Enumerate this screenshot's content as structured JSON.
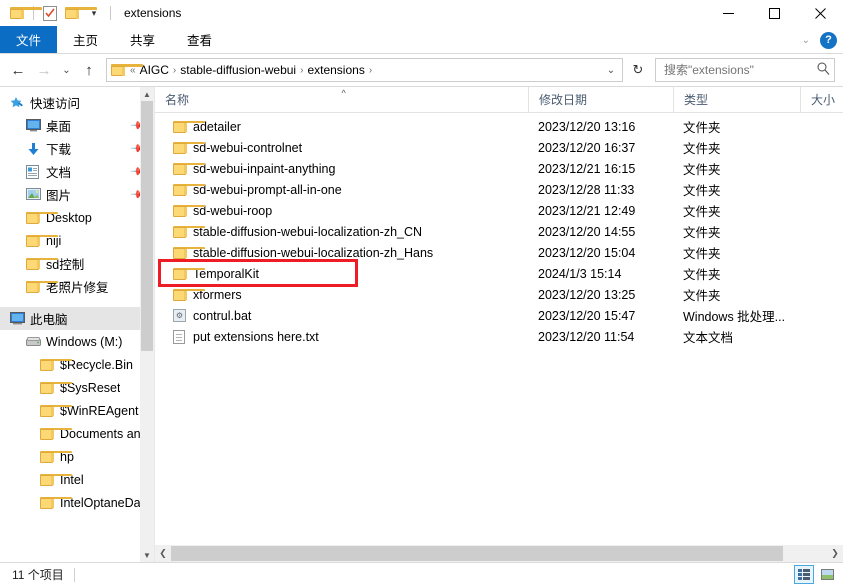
{
  "window": {
    "title": "extensions",
    "controls": {
      "minimize": "—",
      "maximize": "☐",
      "close": "✕"
    },
    "quick_access_toolbar": [
      {
        "name": "folder-icon",
        "label": ""
      },
      {
        "name": "properties-icon",
        "label": ""
      },
      {
        "name": "new-folder-icon",
        "label": ""
      },
      {
        "name": "customize-chevron-icon",
        "label": "▾"
      }
    ]
  },
  "ribbon": {
    "tabs": [
      {
        "label": "文件",
        "active": true
      },
      {
        "label": "主页",
        "active": false
      },
      {
        "label": "共享",
        "active": false
      },
      {
        "label": "查看",
        "active": false
      }
    ],
    "collapse_icon": "⌄",
    "help_icon": "?"
  },
  "navigation": {
    "back": "←",
    "forward": "→",
    "recent": "⌄",
    "up": "↑",
    "refresh": "↻",
    "breadcrumb": {
      "overflow": "«",
      "parts": [
        "AIGC",
        "stable-diffusion-webui",
        "extensions"
      ],
      "separator": "›",
      "dropdown": "⌄"
    },
    "search": {
      "placeholder": "搜索\"extensions\"",
      "value": "",
      "icon": "search-icon"
    }
  },
  "sidebar": {
    "groups": [
      {
        "header": {
          "label": "快速访问",
          "icon": "star-pin-icon"
        },
        "items": [
          {
            "label": "桌面",
            "icon": "desktop-icon",
            "pinned": true
          },
          {
            "label": "下载",
            "icon": "download-icon",
            "pinned": true
          },
          {
            "label": "文档",
            "icon": "documents-icon",
            "pinned": true
          },
          {
            "label": "图片",
            "icon": "pictures-icon",
            "pinned": true
          },
          {
            "label": "Desktop",
            "icon": "folder-icon",
            "pinned": false
          },
          {
            "label": "niji",
            "icon": "folder-icon",
            "pinned": false
          },
          {
            "label": "sd控制",
            "icon": "folder-icon",
            "pinned": false
          },
          {
            "label": "老照片修复",
            "icon": "folder-icon",
            "pinned": false
          }
        ]
      },
      {
        "header": {
          "label": "此电脑",
          "icon": "this-pc-icon",
          "selected": true
        },
        "items": [
          {
            "label": "Windows (M:)",
            "icon": "drive-icon",
            "level": 1
          },
          {
            "label": "$Recycle.Bin",
            "icon": "folder-icon",
            "level": 2
          },
          {
            "label": "$SysReset",
            "icon": "folder-icon",
            "level": 2
          },
          {
            "label": "$WinREAgent",
            "icon": "folder-icon",
            "level": 2
          },
          {
            "label": "Documents and S",
            "icon": "folder-icon",
            "level": 2
          },
          {
            "label": "hp",
            "icon": "folder-icon",
            "level": 2
          },
          {
            "label": "Intel",
            "icon": "folder-icon",
            "level": 2
          },
          {
            "label": "IntelOptaneData",
            "icon": "folder-icon",
            "level": 2
          }
        ]
      }
    ]
  },
  "filelist": {
    "columns": [
      {
        "label": "名称",
        "sorted": "asc",
        "sort_glyph": "^"
      },
      {
        "label": "修改日期"
      },
      {
        "label": "类型"
      },
      {
        "label": "大小"
      }
    ],
    "rows": [
      {
        "name": "adetailer",
        "date": "2023/12/20 13:16",
        "type": "文件夹",
        "size": "",
        "icon": "folder-icon"
      },
      {
        "name": "sd-webui-controlnet",
        "date": "2023/12/20 16:37",
        "type": "文件夹",
        "size": "",
        "icon": "folder-icon"
      },
      {
        "name": "sd-webui-inpaint-anything",
        "date": "2023/12/21 16:15",
        "type": "文件夹",
        "size": "",
        "icon": "folder-icon"
      },
      {
        "name": "sd-webui-prompt-all-in-one",
        "date": "2023/12/28 11:33",
        "type": "文件夹",
        "size": "",
        "icon": "folder-icon"
      },
      {
        "name": "sd-webui-roop",
        "date": "2023/12/21 12:49",
        "type": "文件夹",
        "size": "",
        "icon": "folder-icon"
      },
      {
        "name": "stable-diffusion-webui-localization-zh_CN",
        "date": "2023/12/20 14:55",
        "type": "文件夹",
        "size": "",
        "icon": "folder-icon"
      },
      {
        "name": "stable-diffusion-webui-localization-zh_Hans",
        "date": "2023/12/20 15:04",
        "type": "文件夹",
        "size": "",
        "icon": "folder-icon"
      },
      {
        "name": "TemporalKit",
        "date": "2024/1/3 15:14",
        "type": "文件夹",
        "size": "",
        "icon": "folder-icon",
        "highlighted": true
      },
      {
        "name": "xformers",
        "date": "2023/12/20 13:25",
        "type": "文件夹",
        "size": "",
        "icon": "folder-icon"
      },
      {
        "name": "contrul.bat",
        "date": "2023/12/20 15:47",
        "type": "Windows 批处理...",
        "size": "",
        "icon": "bat-file-icon"
      },
      {
        "name": "put extensions here.txt",
        "date": "2023/12/20 11:54",
        "type": "文本文档",
        "size": "",
        "icon": "txt-file-icon"
      }
    ]
  },
  "annotation": {
    "color": "#ee1c25",
    "target": "TemporalKit"
  },
  "statusbar": {
    "item_count": "11 个项目",
    "views": [
      {
        "name": "details-view-button",
        "active": true
      },
      {
        "name": "large-icons-view-button",
        "active": false
      }
    ]
  }
}
